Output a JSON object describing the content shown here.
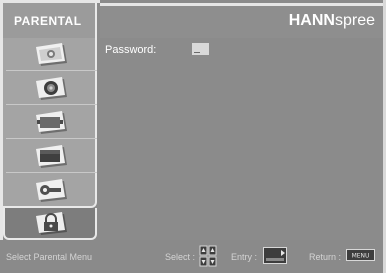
{
  "sidebar": {
    "title": "PARENTAL",
    "items": [
      {
        "icon": "picture-icon"
      },
      {
        "icon": "audio-icon"
      },
      {
        "icon": "display-icon"
      },
      {
        "icon": "screen-icon"
      },
      {
        "icon": "setup-icon"
      },
      {
        "icon": "parental-lock-icon",
        "active": true
      }
    ]
  },
  "header": {
    "brand_bold": "HANN",
    "brand_light": "spree"
  },
  "content": {
    "password_label": "Password:",
    "password_value": "_"
  },
  "footer": {
    "menu_hint": "Select Parental Menu",
    "select_label": "Select :",
    "entry_label": "Entry :",
    "return_label": "Return :",
    "return_key": "MENU"
  },
  "colors": {
    "background": "#8b8b8b",
    "sidebar": "#a4a4a4",
    "active": "#7d7d7d",
    "border": "#e9e9e9"
  }
}
